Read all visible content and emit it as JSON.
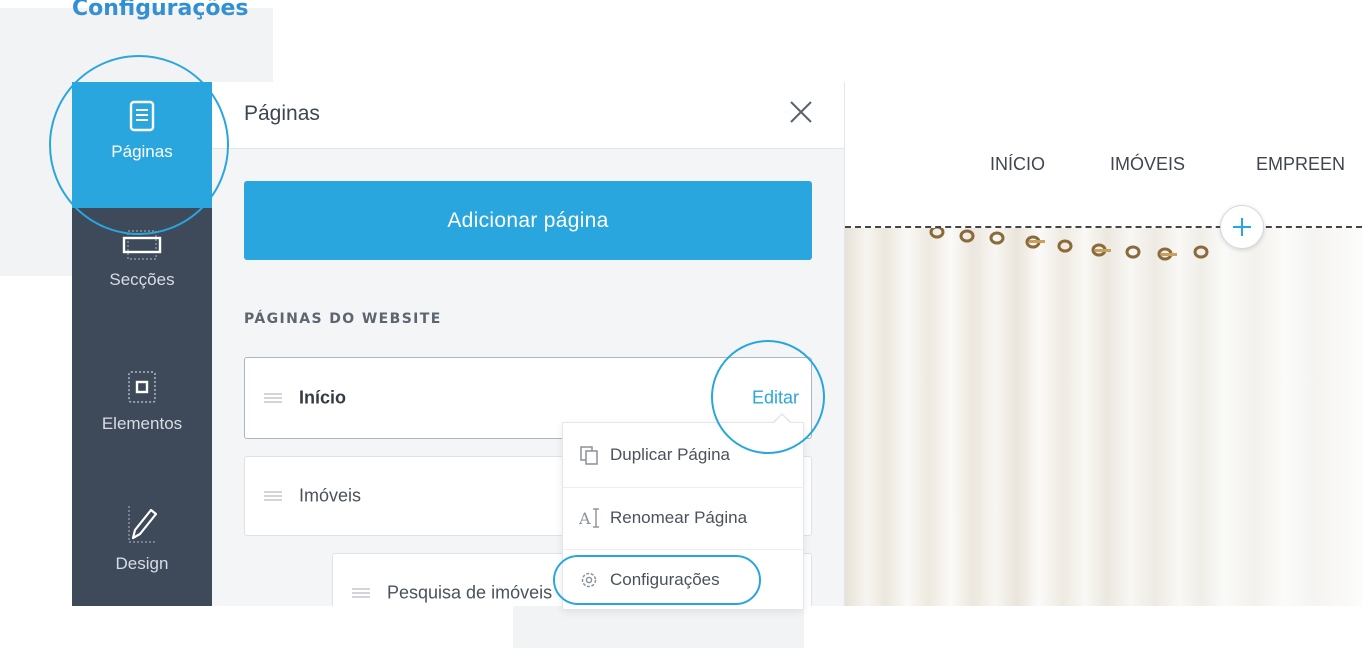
{
  "caption": "Configurações",
  "sidebar": {
    "items": [
      {
        "label": "Páginas",
        "icon": "pages-icon"
      },
      {
        "label": "Secções",
        "icon": "sections-icon"
      },
      {
        "label": "Elementos",
        "icon": "elements-icon"
      },
      {
        "label": "Design",
        "icon": "pen-icon"
      }
    ]
  },
  "panel": {
    "title": "Páginas",
    "close_icon": "close-icon",
    "add_button": "Adicionar página",
    "section_label": "PÁGINAS DO WEBSITE",
    "pages": [
      {
        "label": "Início",
        "edit": "Editar"
      },
      {
        "label": "Imóveis"
      },
      {
        "label": "Pesquisa de imóveis"
      }
    ]
  },
  "menu": {
    "items": [
      {
        "label": "Duplicar Página",
        "icon": "duplicate-icon"
      },
      {
        "label": "Renomear Página",
        "icon": "rename-icon"
      },
      {
        "label": "Configurações",
        "icon": "gear-icon"
      }
    ]
  },
  "preview": {
    "nav": [
      "INÍCIO",
      "IMÓVEIS",
      "EMPREEN"
    ]
  },
  "colors": {
    "accent": "#2aa6de",
    "sidebar": "#3e4a5a",
    "caption": "#2d8fd6"
  }
}
